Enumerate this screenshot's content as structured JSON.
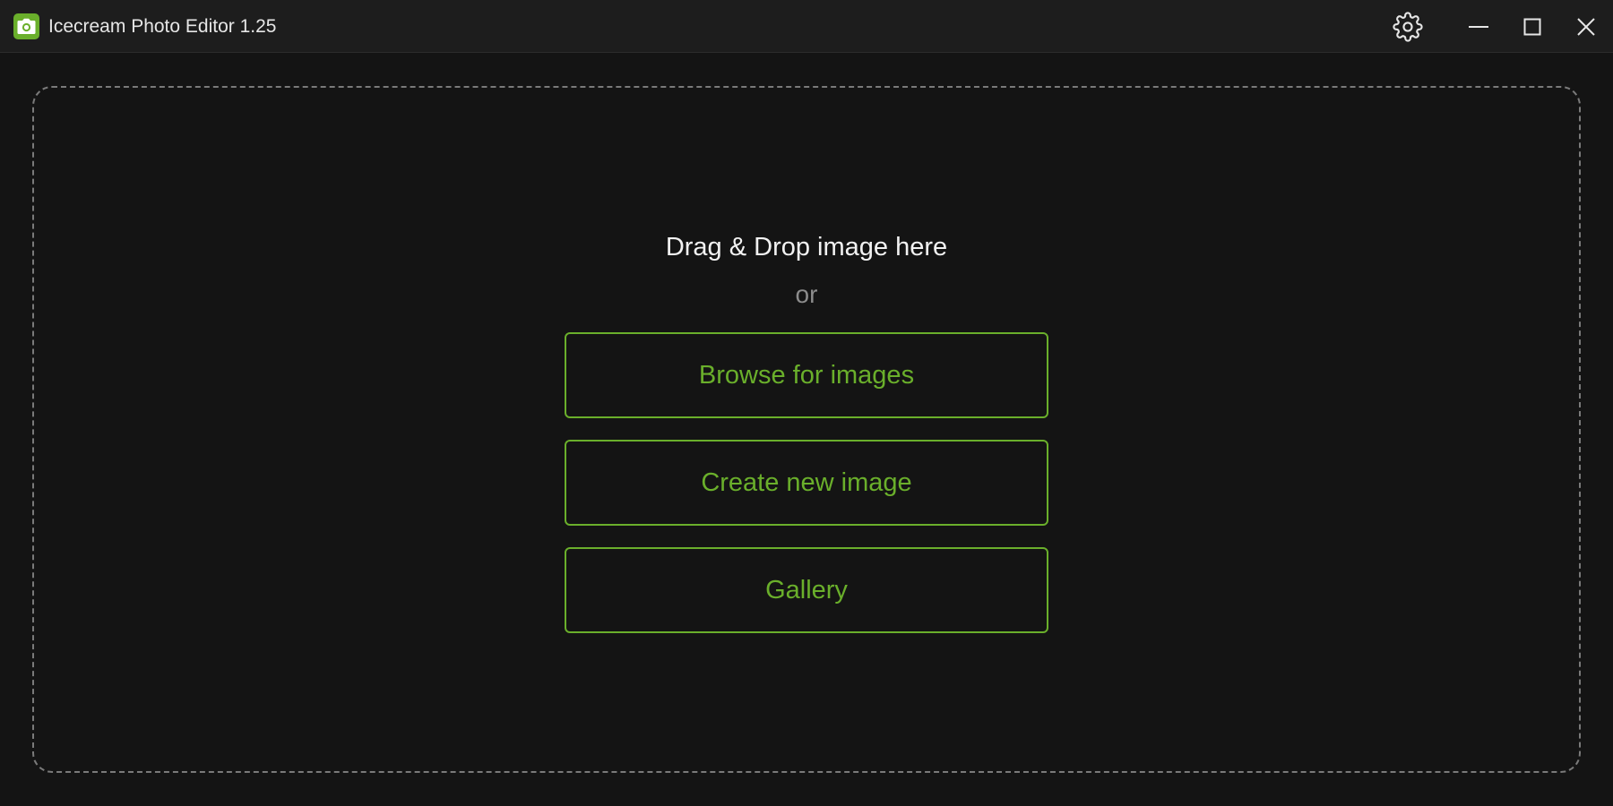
{
  "window": {
    "title": "Icecream Photo Editor 1.25",
    "app_icon": "camera-icon",
    "controls": {
      "settings": "gear-icon",
      "minimize": "minimize-icon",
      "maximize": "maximize-icon",
      "close": "close-icon"
    }
  },
  "drop_zone": {
    "title": "Drag & Drop image here",
    "or_text": "or"
  },
  "actions": {
    "browse_label": "Browse for images",
    "create_label": "Create new image",
    "gallery_label": "Gallery"
  },
  "colors": {
    "accent": "#6aaf2b",
    "background": "#141414",
    "titlebar": "#1d1d1d",
    "dashed_border": "#7a7a7a"
  }
}
